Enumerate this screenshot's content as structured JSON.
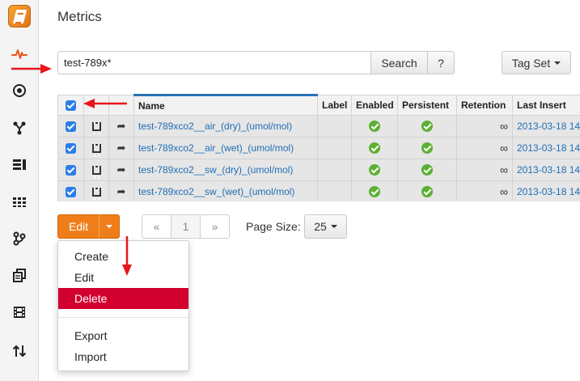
{
  "page": {
    "title": "Metrics"
  },
  "sidebar": {
    "items": [
      {
        "icon": "pulse-icon",
        "label": "Metrics",
        "active": true
      },
      {
        "icon": "target-icon"
      },
      {
        "icon": "network-icon"
      },
      {
        "icon": "list-icon"
      },
      {
        "icon": "grid-icon"
      },
      {
        "icon": "branch-icon"
      },
      {
        "icon": "copy-icon"
      },
      {
        "icon": "film-icon"
      },
      {
        "icon": "sort-arrows-icon"
      }
    ]
  },
  "search": {
    "value": "test-789x*",
    "button_label": "Search",
    "help_label": "?",
    "tagset_label": "Tag Set"
  },
  "table": {
    "columns": [
      "Name",
      "Label",
      "Enabled",
      "Persistent",
      "Retention",
      "Last Insert"
    ],
    "rows": [
      {
        "name": "test-789xco2__air_(dry)_(umol/mol)",
        "label": "",
        "enabled": true,
        "persistent": true,
        "retention": "∞",
        "last_insert": "2013-03-18 14"
      },
      {
        "name": "test-789xco2__air_(wet)_(umol/mol)",
        "label": "",
        "enabled": true,
        "persistent": true,
        "retention": "∞",
        "last_insert": "2013-03-18 14"
      },
      {
        "name": "test-789xco2__sw_(dry)_(umol/mol)",
        "label": "",
        "enabled": true,
        "persistent": true,
        "retention": "∞",
        "last_insert": "2013-03-18 14"
      },
      {
        "name": "test-789xco2__sw_(wet)_(umol/mol)",
        "label": "",
        "enabled": true,
        "persistent": true,
        "retention": "∞",
        "last_insert": "2013-03-18 14"
      }
    ]
  },
  "actions": {
    "edit_label": "Edit",
    "menu": [
      "Create",
      "Edit",
      "Delete",
      "Export",
      "Import"
    ],
    "active_menu_item": "Delete"
  },
  "pagination": {
    "prev": "«",
    "current": "1",
    "next": "»",
    "page_size_label": "Page Size:",
    "page_size": "25"
  },
  "colors": {
    "accent_orange": "#ef7e1a",
    "danger_red": "#d2002f",
    "link_blue": "#1f6eb5",
    "annotation_red": "#e8151d"
  }
}
